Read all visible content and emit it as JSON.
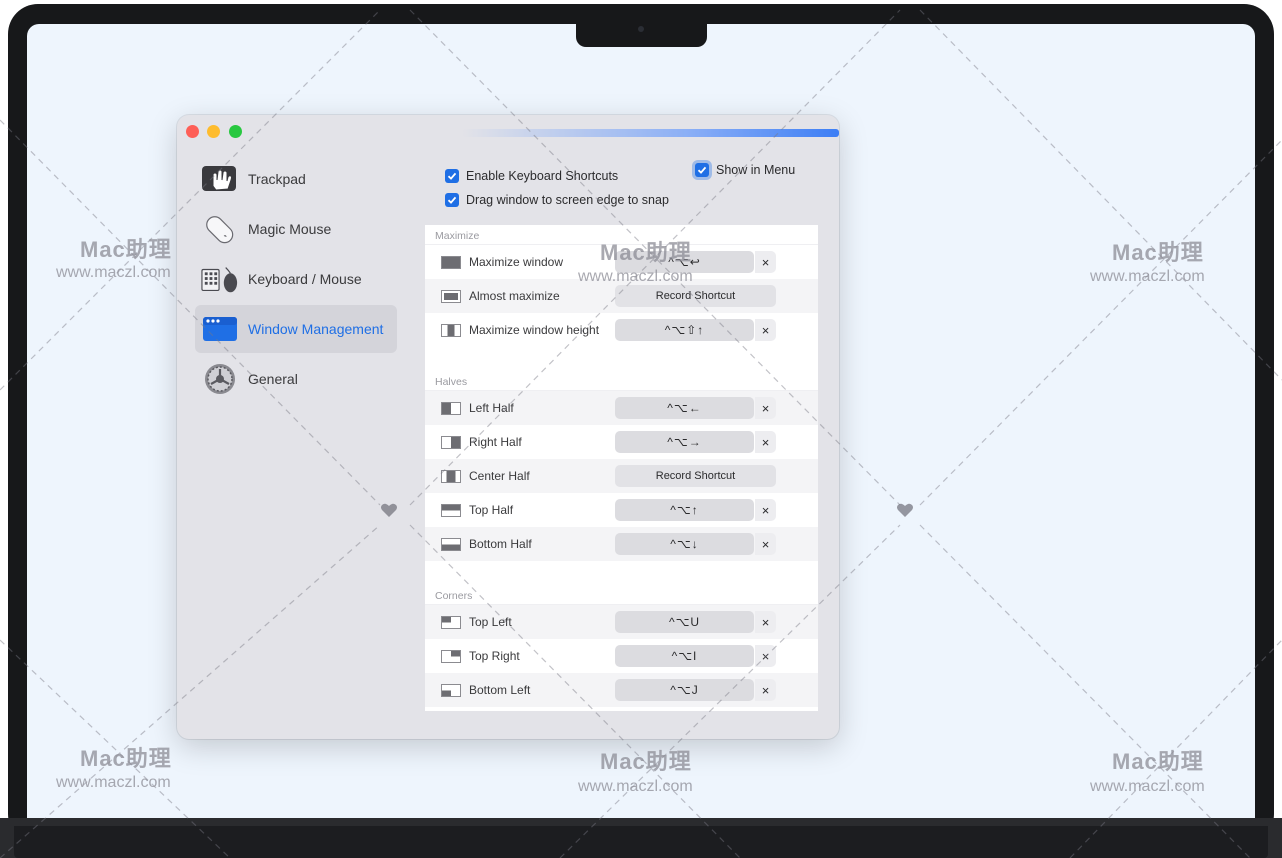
{
  "sidebar": {
    "items": [
      {
        "label": "Trackpad",
        "icon": "trackpad-hand-icon"
      },
      {
        "label": "Magic Mouse",
        "icon": "magic-mouse-icon"
      },
      {
        "label": "Keyboard / Mouse",
        "icon": "keyboard-mouse-icon"
      },
      {
        "label": "Window Management",
        "icon": "window-management-icon",
        "active": true
      },
      {
        "label": "General",
        "icon": "general-gear-icon"
      }
    ]
  },
  "options": {
    "enable_shortcuts": "Enable Keyboard Shortcuts",
    "show_in_menu": "Show in Menu",
    "drag_snap": "Drag window to screen edge to snap"
  },
  "sections": {
    "maximize": {
      "title": "Maximize",
      "rows": [
        {
          "label": "Maximize window",
          "shortcut": "^⌥↩"
        },
        {
          "label": "Almost maximize",
          "record": "Record Shortcut"
        },
        {
          "label": "Maximize window height",
          "shortcut": "^⌥⇧↑"
        }
      ]
    },
    "halves": {
      "title": "Halves",
      "rows": [
        {
          "label": "Left Half",
          "shortcut": "^⌥←"
        },
        {
          "label": "Right Half",
          "shortcut": "^⌥→"
        },
        {
          "label": "Center Half",
          "record": "Record Shortcut"
        },
        {
          "label": "Top Half",
          "shortcut": "^⌥↑"
        },
        {
          "label": "Bottom Half",
          "shortcut": "^⌥↓"
        }
      ]
    },
    "corners": {
      "title": "Corners",
      "rows": [
        {
          "label": "Top Left",
          "shortcut": "^⌥U"
        },
        {
          "label": "Top Right",
          "shortcut": "^⌥I"
        },
        {
          "label": "Bottom Left",
          "shortcut": "^⌥J"
        }
      ]
    }
  },
  "clear_glyph": "×",
  "watermark": {
    "title": "Mac助理",
    "url": "www.maczl.com"
  },
  "colors": {
    "accent": "#1f6fe5",
    "close": "#fe5f57",
    "minimize": "#febc2e",
    "maximize": "#28c840"
  }
}
